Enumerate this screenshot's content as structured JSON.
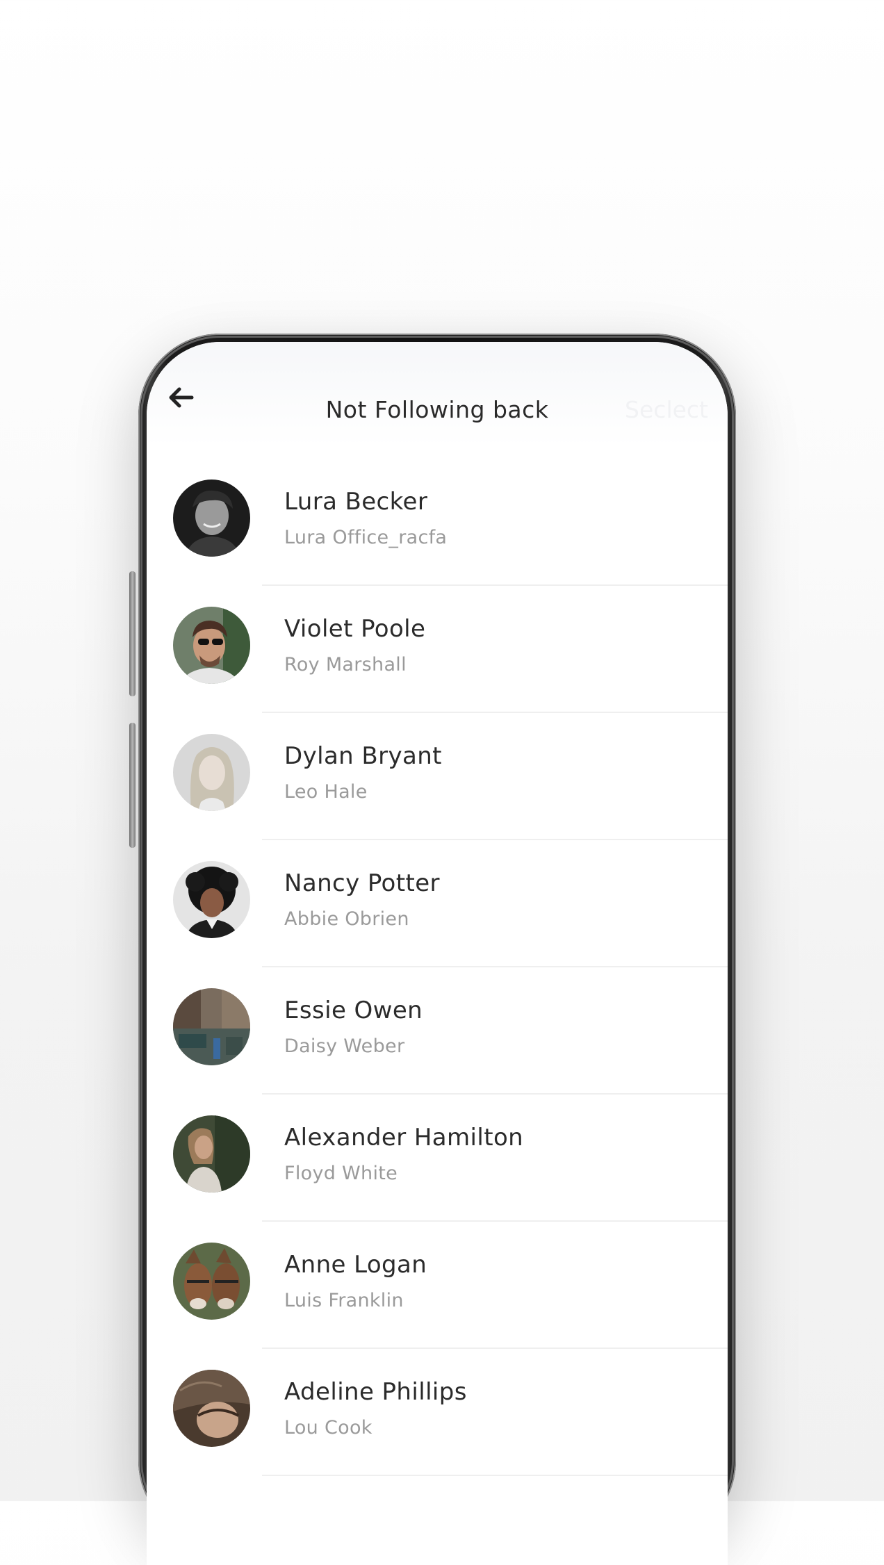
{
  "header": {
    "title": "Not Following back",
    "select_label": "Seclect",
    "back_icon": "arrow-left-icon"
  },
  "users": [
    {
      "name": "Lura Becker",
      "subtitle": "Lura Office_racfa"
    },
    {
      "name": "Violet Poole",
      "subtitle": "Roy Marshall"
    },
    {
      "name": "Dylan Bryant",
      "subtitle": "Leo Hale"
    },
    {
      "name": "Nancy Potter",
      "subtitle": "Abbie Obrien"
    },
    {
      "name": "Essie Owen",
      "subtitle": "Daisy Weber"
    },
    {
      "name": "Alexander Hamilton",
      "subtitle": "Floyd White"
    },
    {
      "name": "Anne Logan",
      "subtitle": "Luis Franklin"
    },
    {
      "name": "Adeline Phillips",
      "subtitle": "Lou Cook"
    }
  ],
  "colors": {
    "title_text": "#2a2a2a",
    "subtitle_text": "#9a9a9a",
    "divider": "#efefef"
  }
}
